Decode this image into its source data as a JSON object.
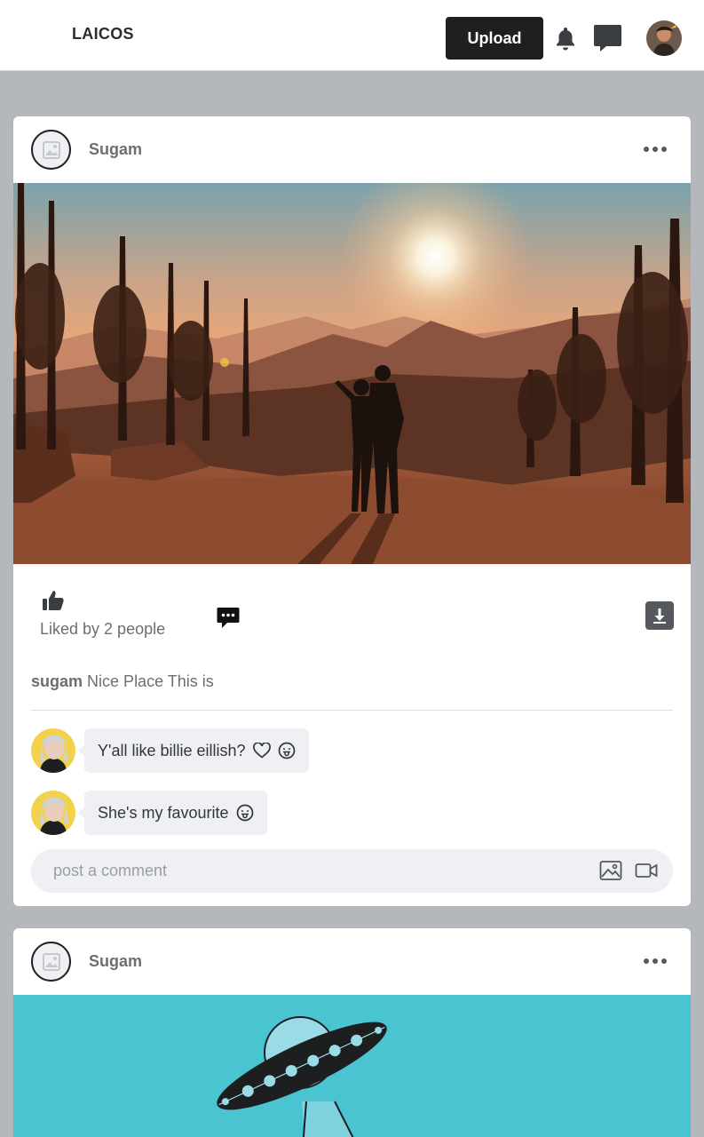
{
  "header": {
    "brand": "LAICOS",
    "upload_label": "Upload",
    "icons": [
      "bell-icon",
      "message-icon",
      "user-avatar"
    ]
  },
  "posts": [
    {
      "author": "Sugam",
      "image": "sunset-mountain-couple-photo",
      "likes_text": "Liked by 2 people",
      "caption_user": "sugam",
      "caption_text": "Nice Place This is",
      "comments": [
        {
          "text": "Y'all like billie eillish?",
          "icons": [
            "heart-icon",
            "tongue-emoji-icon"
          ]
        },
        {
          "text": "She's my favourite",
          "icons": [
            "tongue-emoji-icon"
          ]
        }
      ],
      "comment_placeholder": "post a comment"
    },
    {
      "author": "Sugam",
      "image": "ufo-illustration"
    }
  ],
  "colors": {
    "background": "#b4b7bc",
    "upload_button": "#1e1f21",
    "comment_bubble": "#eef0f3",
    "ufo_sky": "#4ac4d1"
  }
}
